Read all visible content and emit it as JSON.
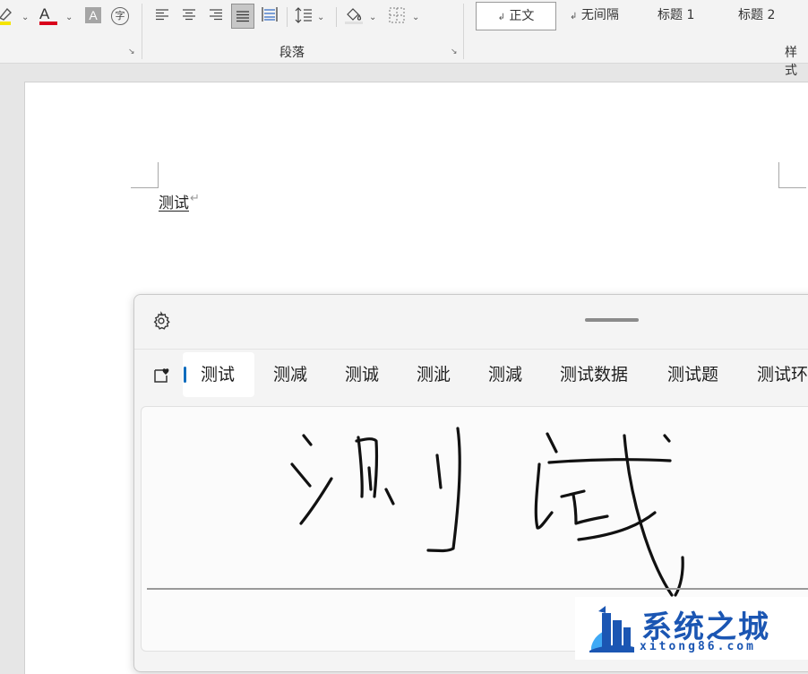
{
  "ribbon": {
    "paragraph_group_label": "段落",
    "styles_group_label": "样式",
    "styles": [
      "正文",
      "无间隔",
      "标题 1",
      "标题 2"
    ],
    "font_color_letter": "A",
    "shade_letter": "A",
    "phonetic_glyph": "字"
  },
  "document": {
    "text": "测试"
  },
  "handwriting_panel": {
    "candidates": [
      "测试",
      "测减",
      "测诚",
      "测泚",
      "测減",
      "测试数据",
      "测试题",
      "测试环"
    ]
  },
  "watermark": {
    "title": "系统之城",
    "url": "xitong86.com"
  },
  "colors": {
    "highlight": "#f5e400",
    "font_color": "#d9001b",
    "accent": "#0f6cbd",
    "watermark": "#1b56b3"
  }
}
